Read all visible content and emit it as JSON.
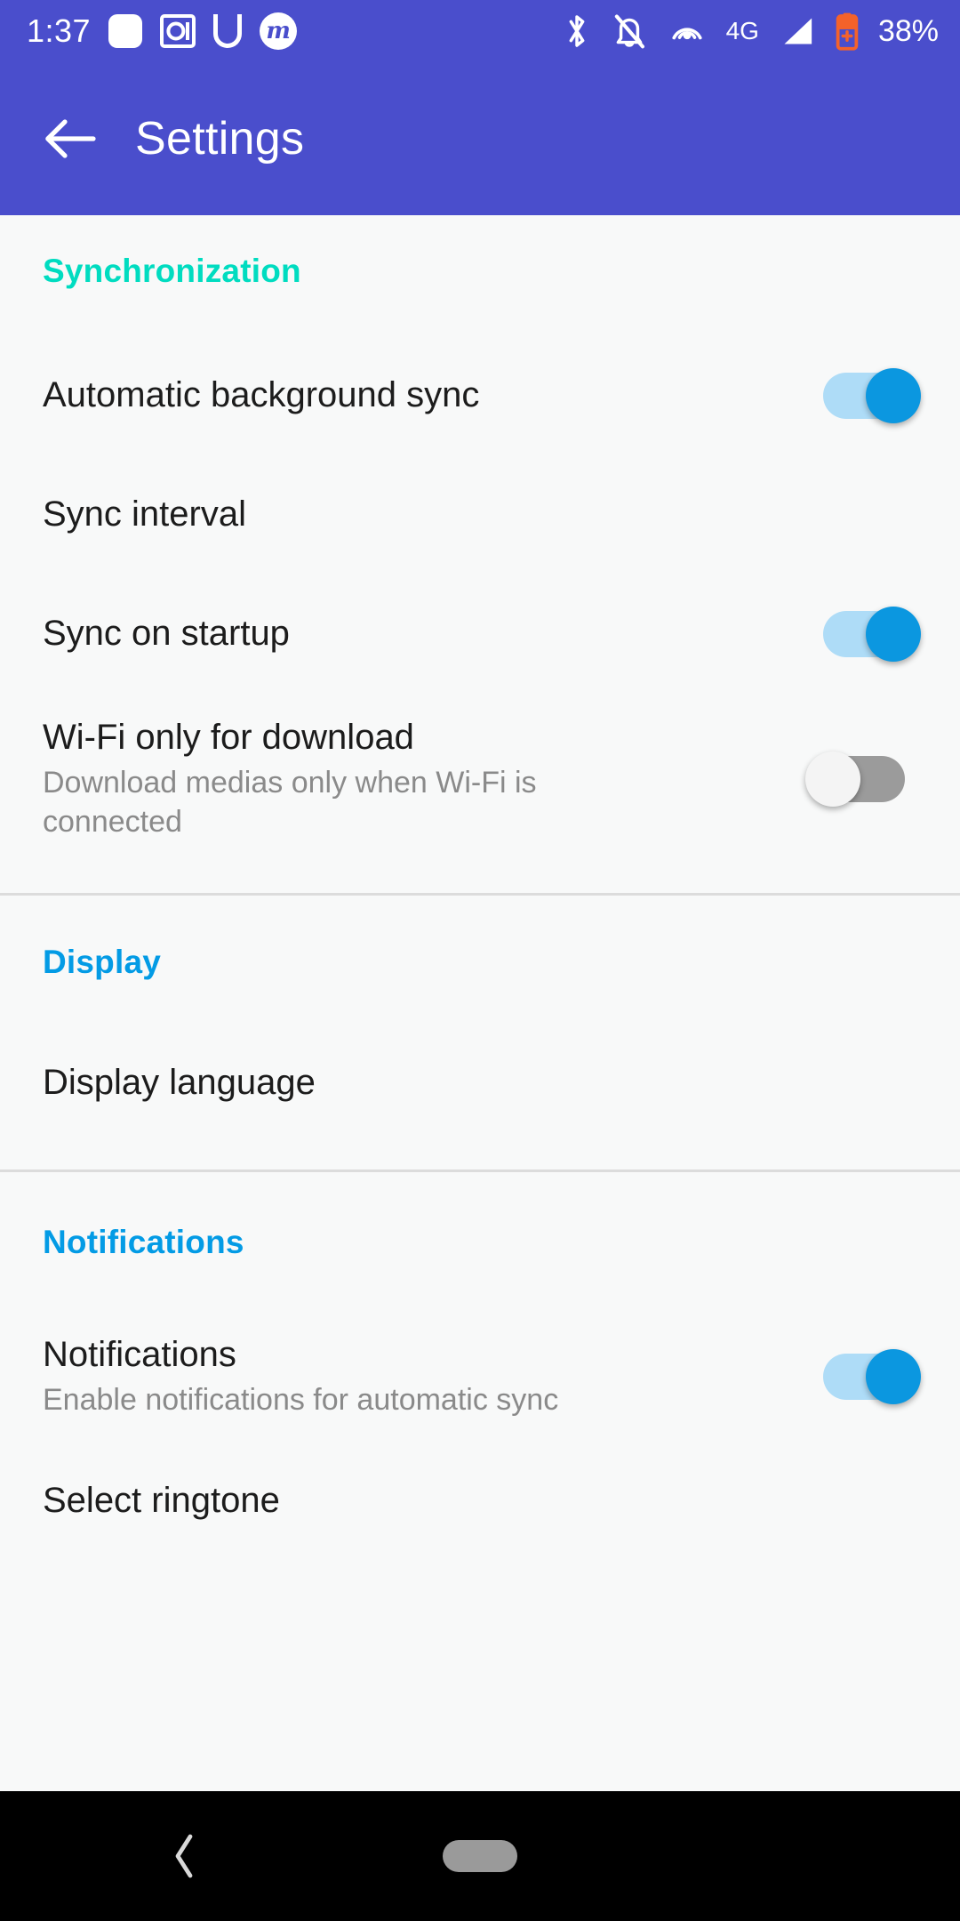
{
  "status_bar": {
    "clock": "1:37",
    "battery_percent": "38%",
    "network_label": "4G",
    "icons": [
      "rounded-square-icon",
      "safe-icon",
      "u-letter-icon",
      "m-badge-icon",
      "bluetooth-icon",
      "notifications-off-icon",
      "hotspot-icon",
      "cellular-signal-icon",
      "battery-charging-icon"
    ],
    "m_badge_letter": "m",
    "background_color": "#4a4ecc"
  },
  "app_bar": {
    "title": "Settings",
    "back_label": "Navigate up",
    "background_color": "#4a4ecc",
    "text_color": "#ffffff"
  },
  "colors": {
    "accent_teal": "#00dcc0",
    "accent_blue": "#039be5",
    "switch_on_thumb": "#0b97e0",
    "switch_on_track": "#aedcf7",
    "switch_off_track": "#9b9b9b",
    "switch_off_thumb": "#f4f4f4",
    "page_background": "#f8f9f9",
    "divider": "#dcdcdc",
    "title_text": "#1c1c1c",
    "summary_text": "#8a8a8a"
  },
  "sections": [
    {
      "header": "Synchronization",
      "header_color": "#00dcc0",
      "rows": [
        {
          "title": "Automatic background sync",
          "summary": "",
          "control": "switch",
          "state": "on"
        },
        {
          "title": "Sync interval",
          "summary": "",
          "control": "none",
          "state": ""
        },
        {
          "title": "Sync on startup",
          "summary": "",
          "control": "switch",
          "state": "on"
        },
        {
          "title": "Wi-Fi only for download",
          "summary": "Download medias only when Wi-Fi is connected",
          "control": "switch",
          "state": "off"
        }
      ]
    },
    {
      "header": "Display",
      "header_color": "#039be5",
      "rows": [
        {
          "title": "Display language",
          "summary": "",
          "control": "none",
          "state": ""
        }
      ]
    },
    {
      "header": "Notifications",
      "header_color": "#039be5",
      "rows": [
        {
          "title": "Notifications",
          "summary": "Enable notifications for automatic sync",
          "control": "switch",
          "state": "on"
        },
        {
          "title": "Select ringtone",
          "summary": "",
          "control": "none",
          "state": ""
        }
      ]
    }
  ],
  "nav_bar": {
    "back_label": "Back",
    "home_label": "Home",
    "background_color": "#000000"
  }
}
